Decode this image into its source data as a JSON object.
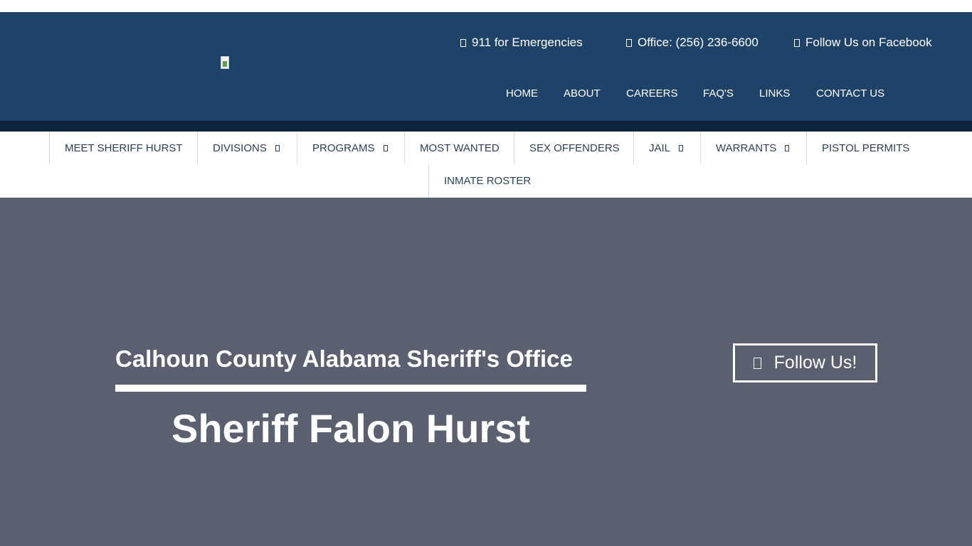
{
  "header": {
    "contacts": [
      {
        "icon": "alert-icon",
        "label": "911 for Emergencies"
      },
      {
        "icon": "phone-icon",
        "label": "Office: (256) 236-6600"
      },
      {
        "icon": "facebook-icon",
        "label": "Follow Us on Facebook"
      }
    ],
    "top_nav": [
      "HOME",
      "ABOUT",
      "CAREERS",
      "FAQ'S",
      "LINKS",
      "CONTACT US"
    ]
  },
  "main_nav": [
    {
      "label": "MEET SHERIFF HURST",
      "dropdown": false
    },
    {
      "label": "DIVISIONS",
      "dropdown": true
    },
    {
      "label": "PROGRAMS",
      "dropdown": true
    },
    {
      "label": "MOST WANTED",
      "dropdown": false
    },
    {
      "label": "SEX OFFENDERS",
      "dropdown": false
    },
    {
      "label": "JAIL",
      "dropdown": true
    },
    {
      "label": "WARRANTS",
      "dropdown": true
    },
    {
      "label": "PISTOL PERMITS",
      "dropdown": false
    },
    {
      "label": "INMATE ROSTER",
      "dropdown": false
    }
  ],
  "hero": {
    "subtitle": "Calhoun County Alabama Sheriff's Office",
    "title": "Sheriff Falon Hurst",
    "follow_button": "Follow Us!",
    "follow_icon": "facebook-icon"
  },
  "colors": {
    "header_bg": "#1f4268",
    "header_band": "#0c2440",
    "hero_bg": "#5a6070",
    "nav_text": "#2b3f58"
  }
}
